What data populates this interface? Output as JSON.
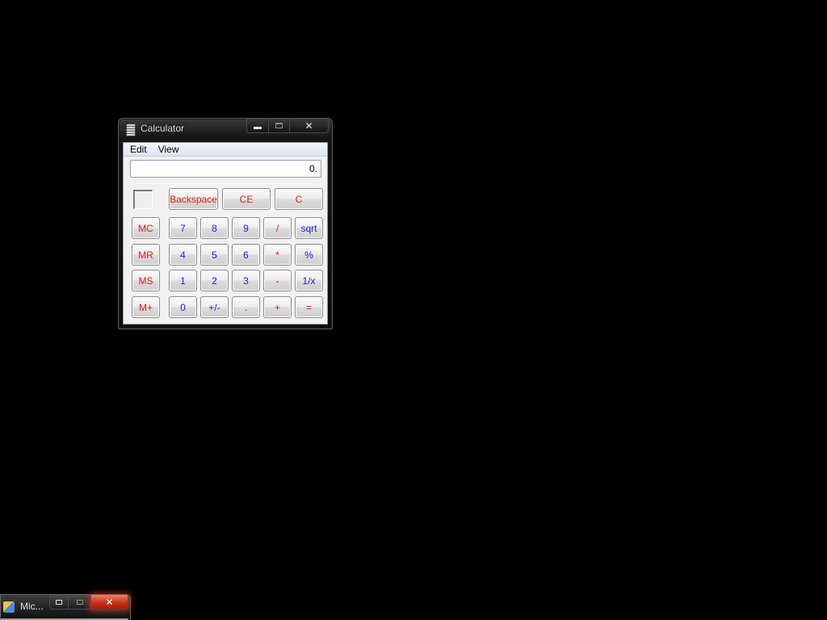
{
  "calculator": {
    "title": "Calculator",
    "caption": {
      "minimize_icon": "minimize-icon",
      "maximize_icon": "maximize-icon",
      "close_glyph": "✕"
    },
    "menu": [
      "Edit",
      "View"
    ],
    "display": "0.",
    "top_row": {
      "backspace": "Backspace",
      "ce": "CE",
      "c": "C"
    },
    "memory": [
      "MC",
      "MR",
      "MS",
      "M+"
    ],
    "keys": {
      "row1": [
        "7",
        "8",
        "9",
        "/",
        "sqrt"
      ],
      "row2": [
        "4",
        "5",
        "6",
        "*",
        "%"
      ],
      "row3": [
        "1",
        "2",
        "3",
        "-",
        "1/x"
      ],
      "row4": [
        "0",
        "+/-",
        ".",
        "+",
        "="
      ]
    },
    "colors": {
      "red_keys": "#e11b1b",
      "blue_keys": "#2323c8",
      "desktop": "#000000"
    }
  },
  "taskbar_window": {
    "title": "Mic...",
    "close_glyph": "✕",
    "icons": [
      "app-icon",
      "restore-icon",
      "maximize-icon",
      "close-icon"
    ]
  }
}
